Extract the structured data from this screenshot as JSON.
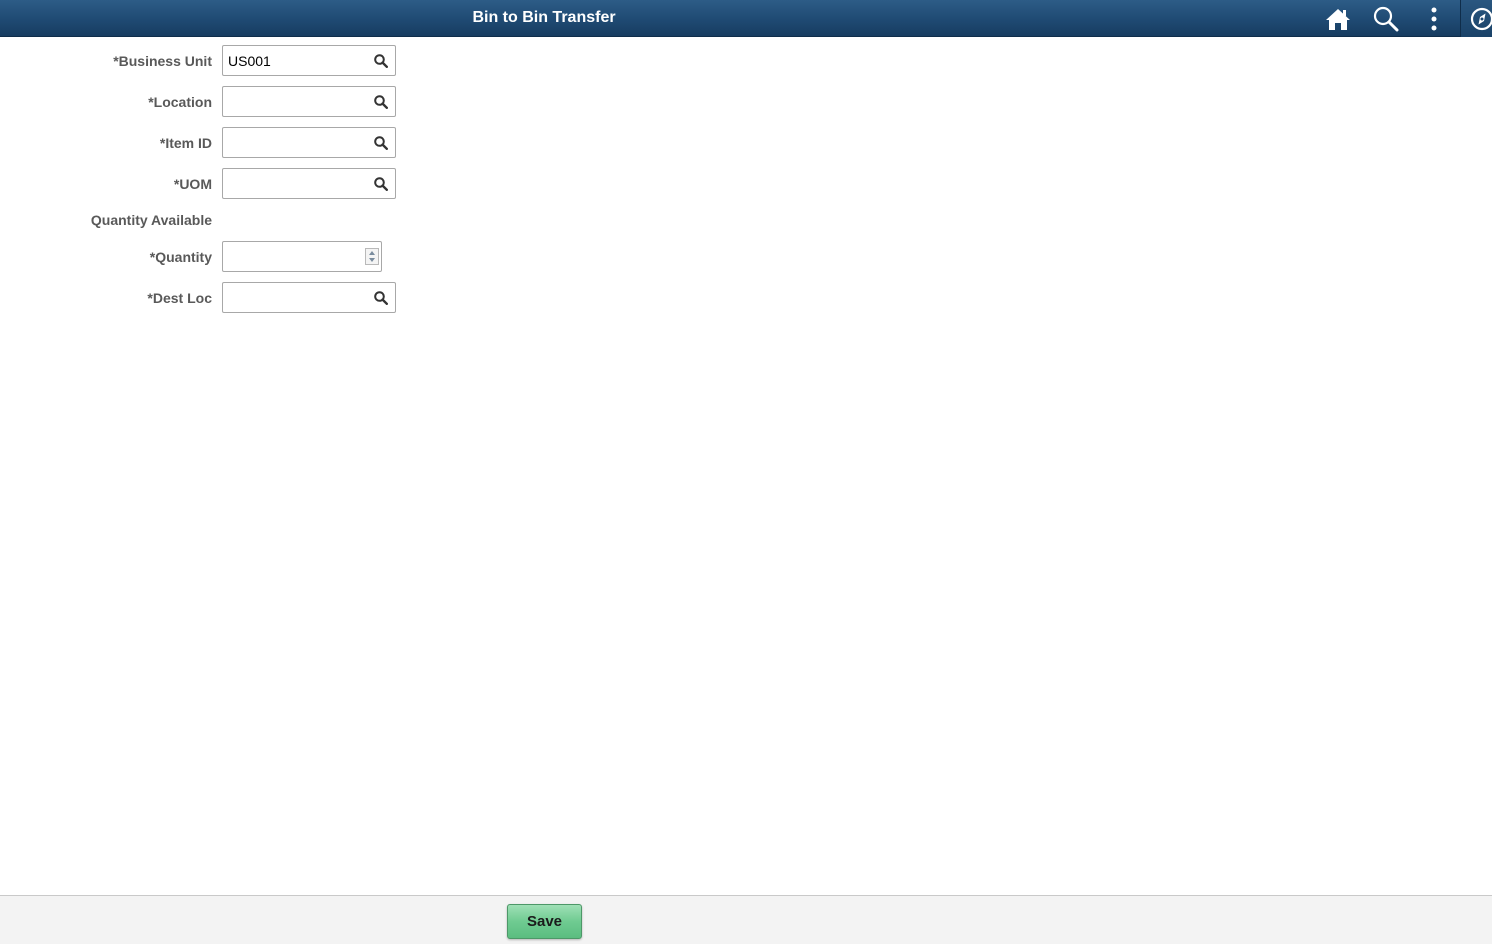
{
  "header": {
    "title": "Bin to Bin Transfer",
    "icons": {
      "home": "home-icon",
      "search": "search-icon",
      "menu": "kebab-menu-icon",
      "navbar": "compass-icon"
    }
  },
  "form": {
    "business_unit": {
      "label": "*Business Unit",
      "value": "US001",
      "placeholder": ""
    },
    "location": {
      "label": "*Location",
      "value": "",
      "placeholder": ""
    },
    "item_id": {
      "label": "*Item ID",
      "value": "",
      "placeholder": ""
    },
    "uom": {
      "label": "*UOM",
      "value": "",
      "placeholder": ""
    },
    "quantity_available": {
      "label": "Quantity Available",
      "value": ""
    },
    "quantity": {
      "label": "*Quantity",
      "value": "",
      "placeholder": ""
    },
    "dest_loc": {
      "label": "*Dest Loc",
      "value": "",
      "placeholder": ""
    }
  },
  "footer": {
    "save_label": "Save"
  },
  "colors": {
    "header_bg": "#1f4a73",
    "label_text": "#595959",
    "save_button": "#6fcb91",
    "footer_bg": "#f3f3f3"
  }
}
